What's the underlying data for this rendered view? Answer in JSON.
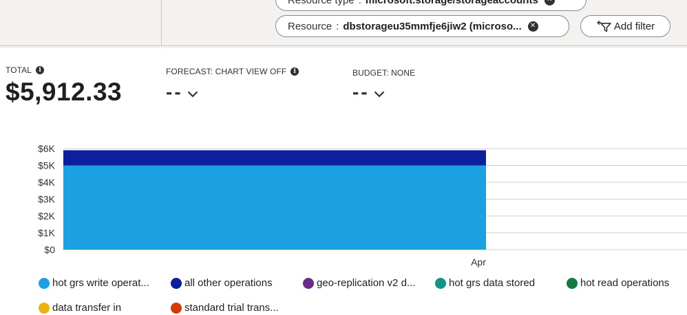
{
  "filters": {
    "resource_type": {
      "key": "Resource type",
      "sep": ":",
      "value": "microsoft.storage/storageaccounts"
    },
    "resource": {
      "key": "Resource",
      "sep": ":",
      "value": "dbstorageu35mmfje6jiw2 (microso..."
    },
    "add_filter_label": "Add filter"
  },
  "kpis": {
    "total": {
      "label": "TOTAL",
      "value": "$5,912.33"
    },
    "forecast": {
      "label": "FORECAST: CHART VIEW OFF",
      "value": "--"
    },
    "budget": {
      "label": "BUDGET: NONE",
      "value": "--"
    }
  },
  "chart_data": {
    "type": "bar",
    "stacked": true,
    "categories": [
      "Apr"
    ],
    "series": [
      {
        "name": "hot grs write operat...",
        "values": [
          5000
        ],
        "color": "#1ba1e2"
      },
      {
        "name": "all other operations",
        "values": [
          900
        ],
        "color": "#0c1f9c"
      }
    ],
    "y_ticks": [
      "$6K",
      "$5K",
      "$4K",
      "$3K",
      "$2K",
      "$1K",
      "$0"
    ],
    "ylim": [
      0,
      6000
    ],
    "grid": true
  },
  "legend": [
    {
      "label": "hot grs write operat...",
      "color": "#1ba1e2"
    },
    {
      "label": "all other operations",
      "color": "#0c1f9c"
    },
    {
      "label": "geo-replication v2 d...",
      "color": "#6b2d86"
    },
    {
      "label": "hot grs data stored",
      "color": "#109588"
    },
    {
      "label": "hot read operations",
      "color": "#107c41"
    },
    {
      "label": "data transfer in",
      "color": "#ecb20f"
    },
    {
      "label": "standard trial trans...",
      "color": "#d83b01"
    }
  ],
  "icons": {
    "remove_filter": "close-circle-icon",
    "add_filter": "filter-add-icon",
    "info": "info-icon",
    "dropdown": "chevron-down-icon"
  }
}
